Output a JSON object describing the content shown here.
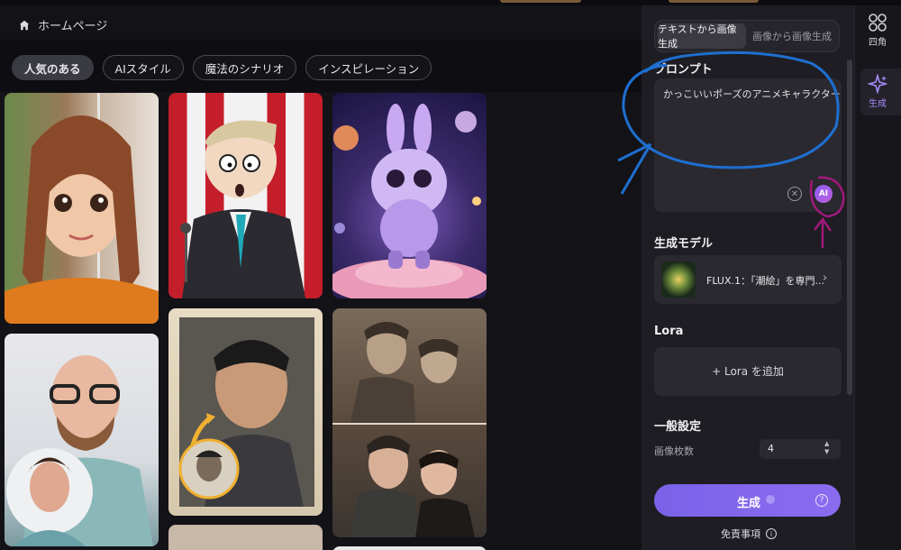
{
  "breadcrumb": {
    "label": "ホームページ"
  },
  "categories": [
    {
      "label": "人気のある",
      "active": true
    },
    {
      "label": "AIスタイル",
      "active": false
    },
    {
      "label": "魔法のシナリオ",
      "active": false
    },
    {
      "label": "インスピレーション",
      "active": false
    }
  ],
  "panel": {
    "tabs": [
      "テキストから画像生成",
      "画像から画像生成"
    ],
    "prompt_label": "プロンプト",
    "prompt_value": "かっこいいポーズのアニメキャラクター",
    "ai_button": "AI",
    "model_label": "生成モデル",
    "model_name": "FLUX.1：「潮絵」を専門...",
    "lora_label": "Lora",
    "lora_add": "+ Lora を追加",
    "general_label": "一般設定",
    "count_label": "画像枚数",
    "count_value": "4",
    "generate_label": "生成",
    "disclaimer": "免責事項"
  },
  "rail": [
    {
      "label": "四角",
      "icon": "grid-icon",
      "active": false
    },
    {
      "label": "生成",
      "icon": "sparkle-icon",
      "active": true
    }
  ],
  "colors": {
    "accent": "#7a62e8",
    "annotation_blue": "#1e6fd0",
    "annotation_magenta": "#a0197a"
  }
}
